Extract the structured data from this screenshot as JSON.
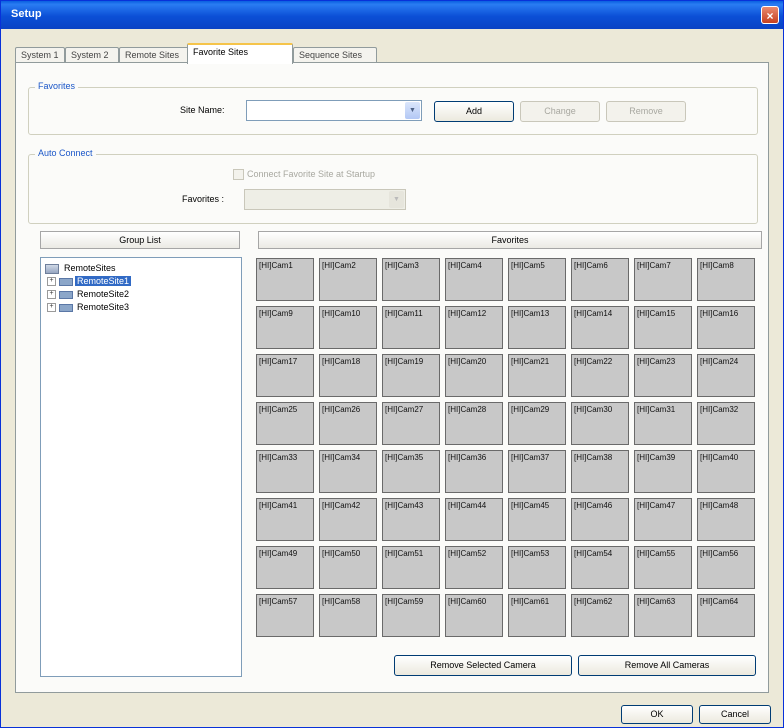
{
  "window": {
    "title": "Setup",
    "close": "×"
  },
  "tabs": [
    "System 1",
    "System 2",
    "Remote Sites",
    "Favorite Sites",
    "Sequence Sites"
  ],
  "active_tab": 3,
  "favorites_group": {
    "title": "Favorites",
    "site_name_label": "Site Name:",
    "site_name_value": "",
    "add": "Add",
    "change": "Change",
    "remove": "Remove"
  },
  "auto_connect_group": {
    "title": "Auto Connect",
    "checkbox_label": "Connect Favorite Site at Startup",
    "favorites_label": "Favorites :",
    "favorites_value": ""
  },
  "group_list": {
    "header": "Group List",
    "root": "RemoteSites",
    "items": [
      {
        "label": "RemoteSite1",
        "selected": true
      },
      {
        "label": "RemoteSite2",
        "selected": false
      },
      {
        "label": "RemoteSite3",
        "selected": false
      }
    ]
  },
  "favorites_panel": {
    "header": "Favorites",
    "cameras": [
      "[HI]Cam1",
      "[HI]Cam2",
      "[HI]Cam3",
      "[HI]Cam4",
      "[HI]Cam5",
      "[HI]Cam6",
      "[HI]Cam7",
      "[HI]Cam8",
      "[HI]Cam9",
      "[HI]Cam10",
      "[HI]Cam11",
      "[HI]Cam12",
      "[HI]Cam13",
      "[HI]Cam14",
      "[HI]Cam15",
      "[HI]Cam16",
      "[HI]Cam17",
      "[HI]Cam18",
      "[HI]Cam19",
      "[HI]Cam20",
      "[HI]Cam21",
      "[HI]Cam22",
      "[HI]Cam23",
      "[HI]Cam24",
      "[HI]Cam25",
      "[HI]Cam26",
      "[HI]Cam27",
      "[HI]Cam28",
      "[HI]Cam29",
      "[HI]Cam30",
      "[HI]Cam31",
      "[HI]Cam32",
      "[HI]Cam33",
      "[HI]Cam34",
      "[HI]Cam35",
      "[HI]Cam36",
      "[HI]Cam37",
      "[HI]Cam38",
      "[HI]Cam39",
      "[HI]Cam40",
      "[HI]Cam41",
      "[HI]Cam42",
      "[HI]Cam43",
      "[HI]Cam44",
      "[HI]Cam45",
      "[HI]Cam46",
      "[HI]Cam47",
      "[HI]Cam48",
      "[HI]Cam49",
      "[HI]Cam50",
      "[HI]Cam51",
      "[HI]Cam52",
      "[HI]Cam53",
      "[HI]Cam54",
      "[HI]Cam55",
      "[HI]Cam56",
      "[HI]Cam57",
      "[HI]Cam58",
      "[HI]Cam59",
      "[HI]Cam60",
      "[HI]Cam61",
      "[HI]Cam62",
      "[HI]Cam63",
      "[HI]Cam64"
    ],
    "remove_selected": "Remove Selected Camera",
    "remove_all": "Remove All Cameras"
  },
  "footer": {
    "ok": "OK",
    "cancel": "Cancel"
  }
}
